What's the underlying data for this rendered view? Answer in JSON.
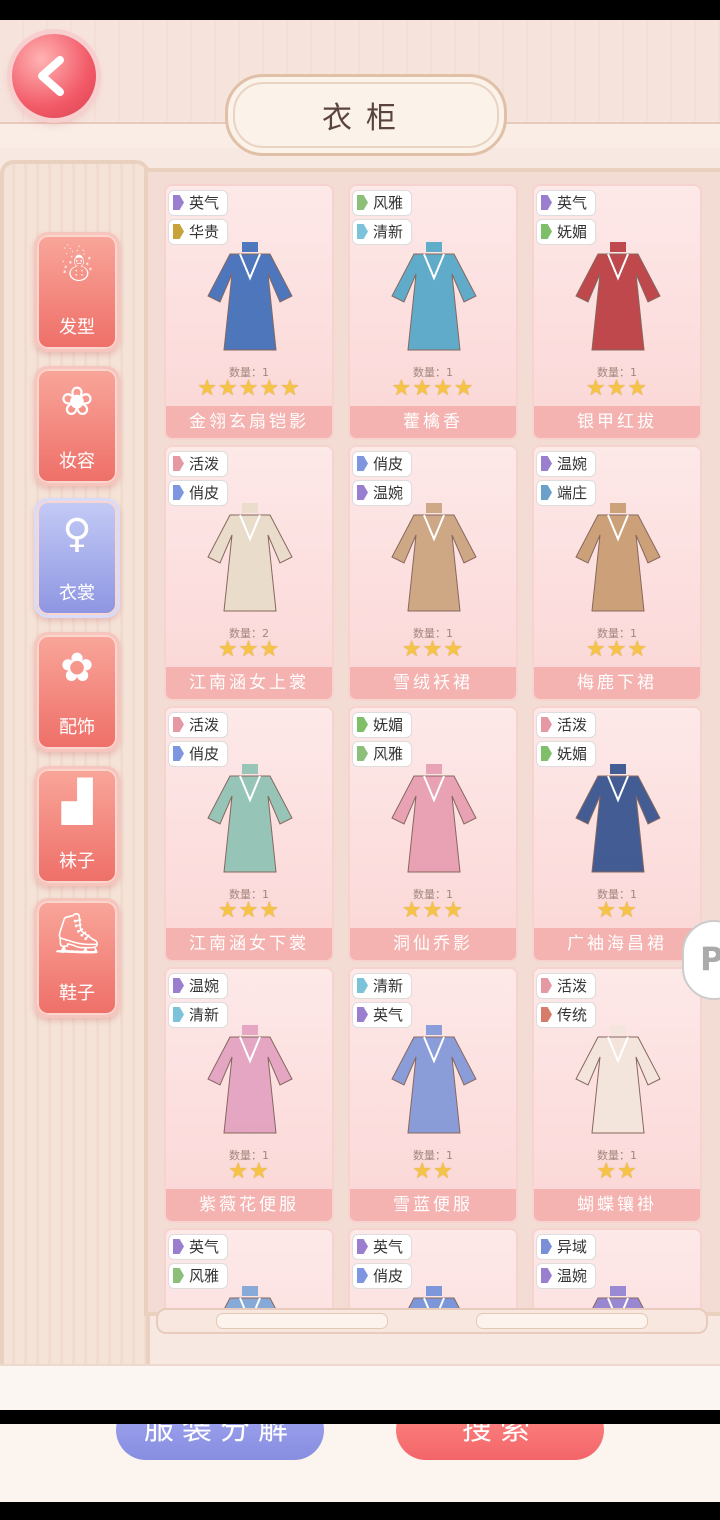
{
  "header": {
    "title": "衣柜",
    "back_icon": "chevron-left-icon"
  },
  "colors": {
    "accent": "#f25a68",
    "active_tab": "#8d95e2",
    "name_bar": "#f4b3b0",
    "star": "#f5c447"
  },
  "categories": [
    {
      "label": "发型",
      "icon": "hair-icon",
      "active": false
    },
    {
      "label": "妆容",
      "icon": "lotus-icon",
      "active": false
    },
    {
      "label": "衣裳",
      "icon": "dress-figure-icon",
      "active": true
    },
    {
      "label": "配饰",
      "icon": "accessory-icon",
      "active": false
    },
    {
      "label": "袜子",
      "icon": "socks-icon",
      "active": false
    },
    {
      "label": "鞋子",
      "icon": "shoes-icon",
      "active": false
    }
  ],
  "items": [
    {
      "tags": [
        "英气",
        "华贵"
      ],
      "qty": "数量：1",
      "stars": "★★★★★",
      "name": "金翎玄扇铠影"
    },
    {
      "tags": [
        "风雅",
        "清新"
      ],
      "qty": "数量：1",
      "stars": "★★★★",
      "name": "藿檎香"
    },
    {
      "tags": [
        "英气",
        "妩媚"
      ],
      "qty": "数量：1",
      "stars": "★★★",
      "name": "银甲红拔"
    },
    {
      "tags": [
        "活泼",
        "俏皮"
      ],
      "qty": "数量：2",
      "stars": "★★★",
      "name": "江南涵女上裳"
    },
    {
      "tags": [
        "俏皮",
        "温婉"
      ],
      "qty": "数量：1",
      "stars": "★★★",
      "name": "雪绒袄裙"
    },
    {
      "tags": [
        "温婉",
        "端庄"
      ],
      "qty": "数量：1",
      "stars": "★★★",
      "name": "梅鹿下裙"
    },
    {
      "tags": [
        "活泼",
        "俏皮"
      ],
      "qty": "数量：1",
      "stars": "★★★",
      "name": "江南涵女下裳"
    },
    {
      "tags": [
        "妩媚",
        "风雅"
      ],
      "qty": "数量：1",
      "stars": "★★★",
      "name": "洞仙乔影"
    },
    {
      "tags": [
        "活泼",
        "妩媚"
      ],
      "qty": "数量：1",
      "stars": "★★",
      "name": "广袖海昌裙"
    },
    {
      "tags": [
        "温婉",
        "清新"
      ],
      "qty": "数量：1",
      "stars": "★★",
      "name": "紫薇花便服"
    },
    {
      "tags": [
        "清新",
        "英气"
      ],
      "qty": "数量：1",
      "stars": "★★",
      "name": "雪蓝便服"
    },
    {
      "tags": [
        "活泼",
        "传统"
      ],
      "qty": "数量：1",
      "stars": "★★",
      "name": "蝴蝶镶褂"
    },
    {
      "tags": [
        "英气",
        "风雅"
      ],
      "qty": "",
      "stars": "",
      "name": ""
    },
    {
      "tags": [
        "英气",
        "俏皮"
      ],
      "qty": "",
      "stars": "",
      "name": ""
    },
    {
      "tags": [
        "异域",
        "温婉"
      ],
      "qty": "",
      "stars": "",
      "name": ""
    }
  ],
  "tag_colors": {
    "英气": "#9a7fd0",
    "华贵": "#c7a33a",
    "风雅": "#8cbf7a",
    "清新": "#7cc3d9",
    "妩媚": "#7fbf6a",
    "活泼": "#e59aa3",
    "俏皮": "#7e95df",
    "温婉": "#9a7fd0",
    "端庄": "#6aa0c9",
    "传统": "#d77b6a",
    "异域": "#7a8fd6"
  },
  "buttons": {
    "decompose": "服装分解",
    "search": "搜索"
  },
  "side_handle_glyph": "P"
}
